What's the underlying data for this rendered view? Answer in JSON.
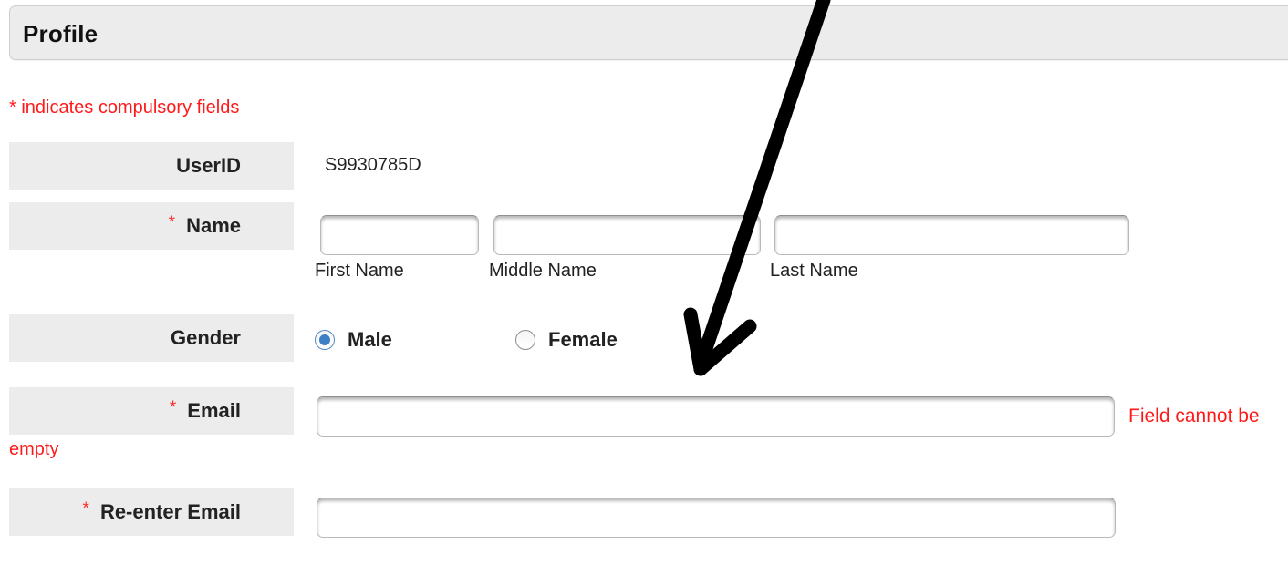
{
  "panel": {
    "title": "Profile"
  },
  "form": {
    "compulsory_note": "* indicates compulsory fields",
    "required_marker": "*",
    "userid": {
      "label": "UserID",
      "value": "S9930785D"
    },
    "name": {
      "label": "Name",
      "first": {
        "value": "",
        "sublabel": "First Name"
      },
      "middle": {
        "value": "",
        "sublabel": "Middle Name"
      },
      "last": {
        "value": "",
        "sublabel": "Last Name"
      }
    },
    "gender": {
      "label": "Gender",
      "options": [
        {
          "label": "Male",
          "checked": true
        },
        {
          "label": "Female",
          "checked": false
        }
      ]
    },
    "email": {
      "label": "Email",
      "value": "",
      "error_line1": "Field cannot be",
      "error_line2": "empty"
    },
    "reenter_email": {
      "label": "Re-enter Email",
      "value": ""
    }
  },
  "annotation": {
    "type": "arrow",
    "color": "#000000"
  },
  "colors": {
    "error_red": "#ff1a1a",
    "label_bg": "#ececec",
    "radio_blue": "#3d7fc4"
  }
}
